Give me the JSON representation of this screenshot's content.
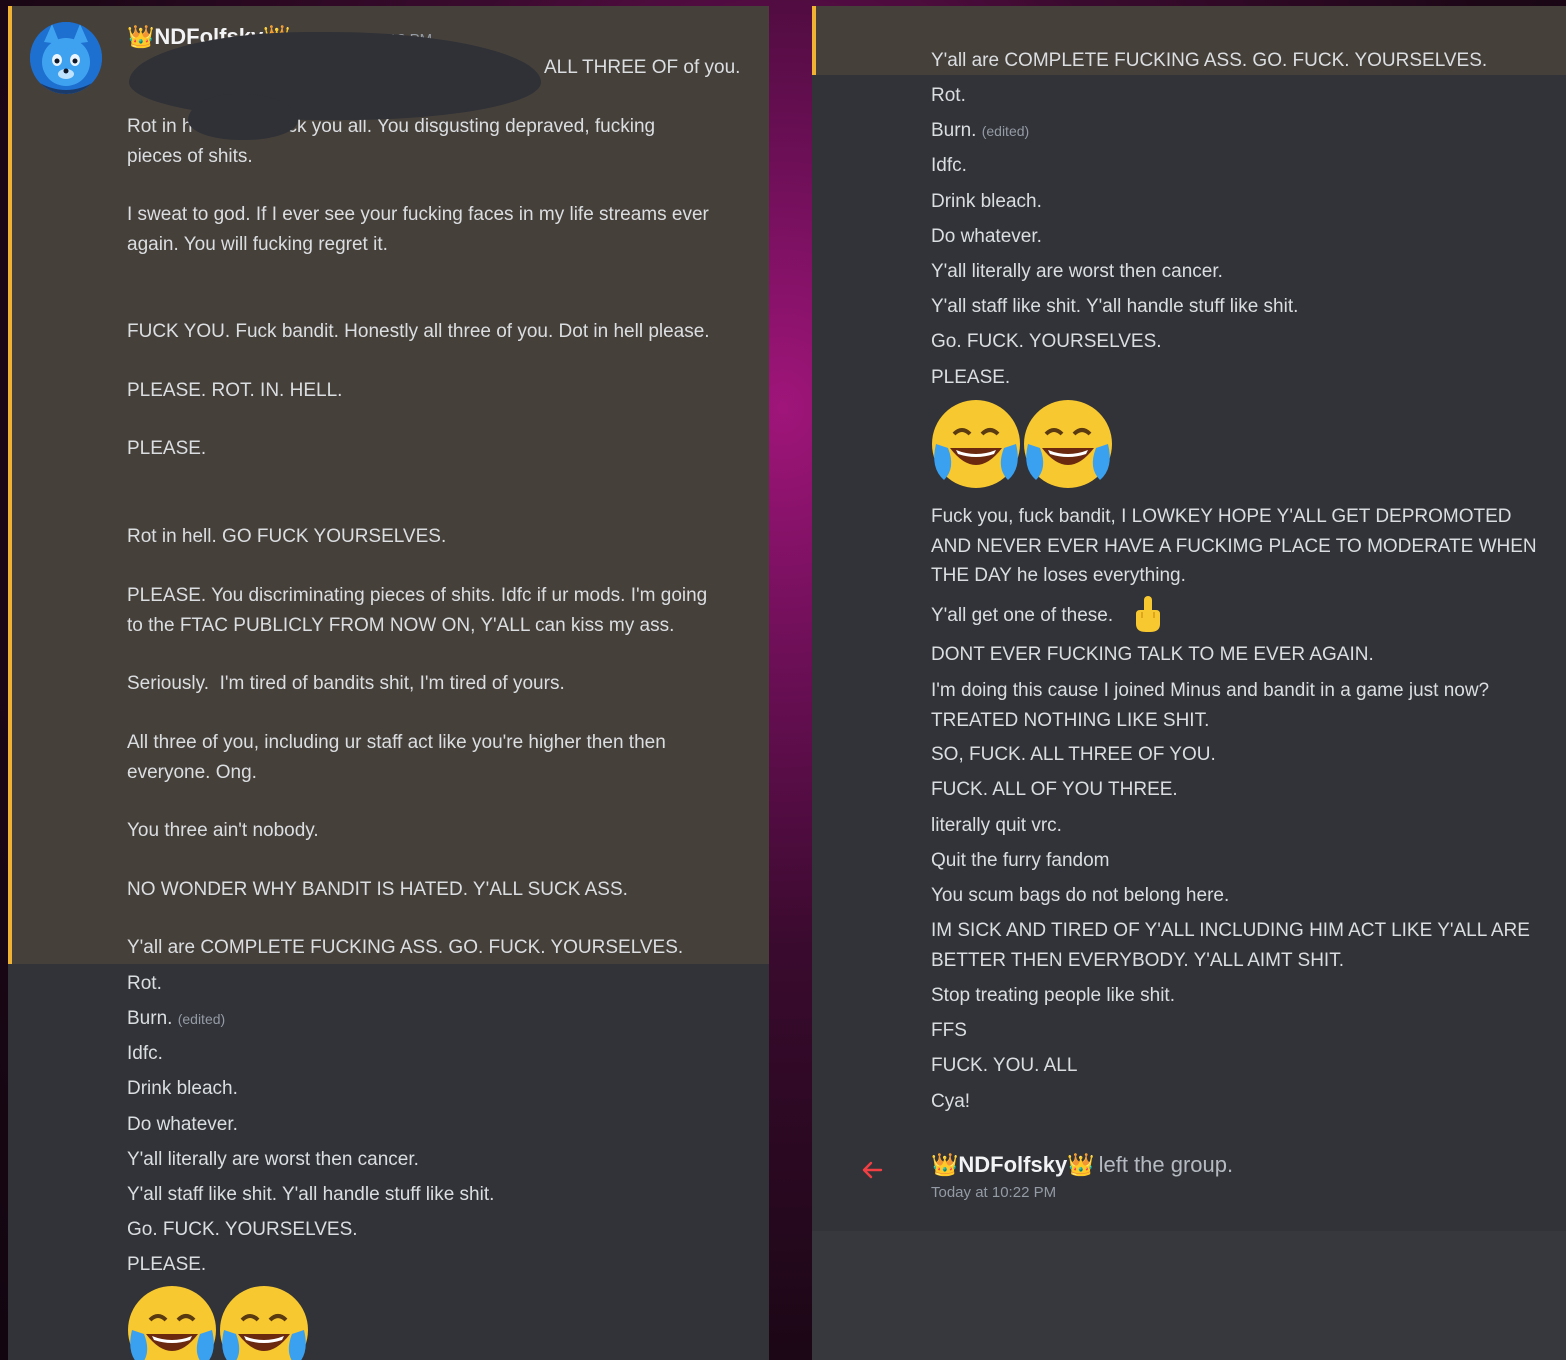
{
  "colors": {
    "accent_border": "#f0b232",
    "highlight_bg": "#46403b",
    "panel_bg": "#313338",
    "leave_arrow": "#f23f43"
  },
  "icons": {
    "crown": "👑",
    "laugh": "😂",
    "middle_finger": "🖕",
    "arrow": "left-arrow-icon"
  },
  "left": {
    "username": "👑NDFolfsky👑",
    "timestamp": "Today at 10:18 PM",
    "messages": {
      "m1": "ALL THREE OF of you.",
      "m2": "Rot in h          k. Fuck you all. You disgusting depraved, fucking\npieces of shits.",
      "m3": "I sweat to god. If I ever see your fucking faces in my life streams ever\nagain. You will fucking regret it.",
      "m4": "FUCK YOU. Fuck bandit. Honestly all three of you. Dot in hell please.",
      "m5": "PLEASE. ROT. IN. HELL.",
      "m6": "PLEASE.",
      "m7": "Rot in hell. GO FUCK YOURSELVES.",
      "m8": "PLEASE. You discriminating pieces of shits. Idfc if ur mods. I'm going\nto the FTAC PUBLICLY FROM NOW ON, Y'ALL can kiss my ass.",
      "m9": "Seriously.  I'm tired of bandits shit, I'm tired of yours.",
      "m10": "All three of you, including ur staff act like you're higher then then\neveryone. Ong.",
      "m11": "You three ain't nobody.",
      "m12": "NO WONDER WHY BANDIT IS HATED. Y'ALL SUCK ASS.",
      "m13": "Y'all are COMPLETE FUCKING ASS. GO. FUCK. YOURSELVES.",
      "m14": "Rot.",
      "m15": "Burn.",
      "m16": "Idfc.",
      "m17": "Drink bleach.",
      "m18": "Do whatever.",
      "m19": "Y'all literally are worst then cancer.",
      "m20": "Y'all staff like shit. Y'all handle stuff like shit.",
      "m21": "Go. FUCK. YOURSELVES.",
      "m22": "PLEASE."
    },
    "edited": "(edited)"
  },
  "right": {
    "messages": {
      "r0": "NO WONDER WHY BANDIT IS HATED. Y'ALL SUCK ASS.",
      "r1": "Y'all are COMPLETE FUCKING ASS. GO. FUCK. YOURSELVES.",
      "r2": "Rot.",
      "r3": "Burn.",
      "r4": "Idfc.",
      "r5": "Drink bleach.",
      "r6": "Do whatever.",
      "r7": "Y'all literally are worst then cancer.",
      "r8": "Y'all staff like shit. Y'all handle stuff like shit.",
      "r9": "Go. FUCK. YOURSELVES.",
      "r10": "PLEASE.",
      "r11": "Fuck you, fuck bandit, I LOWKEY HOPE Y'ALL GET DEPROMOTED\nAND NEVER EVER HAVE A FUCKIMG PLACE TO MODERATE WHEN\nTHE DAY he loses everything.",
      "r12": "Y'all get one of these.",
      "r13": "DONT EVER FUCKING TALK TO ME EVER AGAIN.",
      "r14": "I'm doing this cause I joined Minus and bandit in a game just now?\nTREATED NOTHING LIKE SHIT.",
      "r15": "SO, FUCK. ALL THREE OF YOU.",
      "r16": "FUCK. ALL OF YOU THREE.",
      "r17": "literally quit vrc.",
      "r18": "Quit the furry fandom",
      "r19": "You scum bags do not belong here.",
      "r20": "IM SICK AND TIRED OF Y'ALL INCLUDING HIM ACT LIKE Y'ALL ARE\nBETTER THEN EVERYBODY. Y'ALL AIMT SHIT.",
      "r21": "Stop treating people like shit.",
      "r22": "FFS",
      "r23": "FUCK. YOU. ALL",
      "r24": "Cya!"
    },
    "edited": "(edited)",
    "system": {
      "username": "👑NDFolfsky👑",
      "text": "left the group.",
      "timestamp": "Today at 10:22 PM"
    }
  }
}
